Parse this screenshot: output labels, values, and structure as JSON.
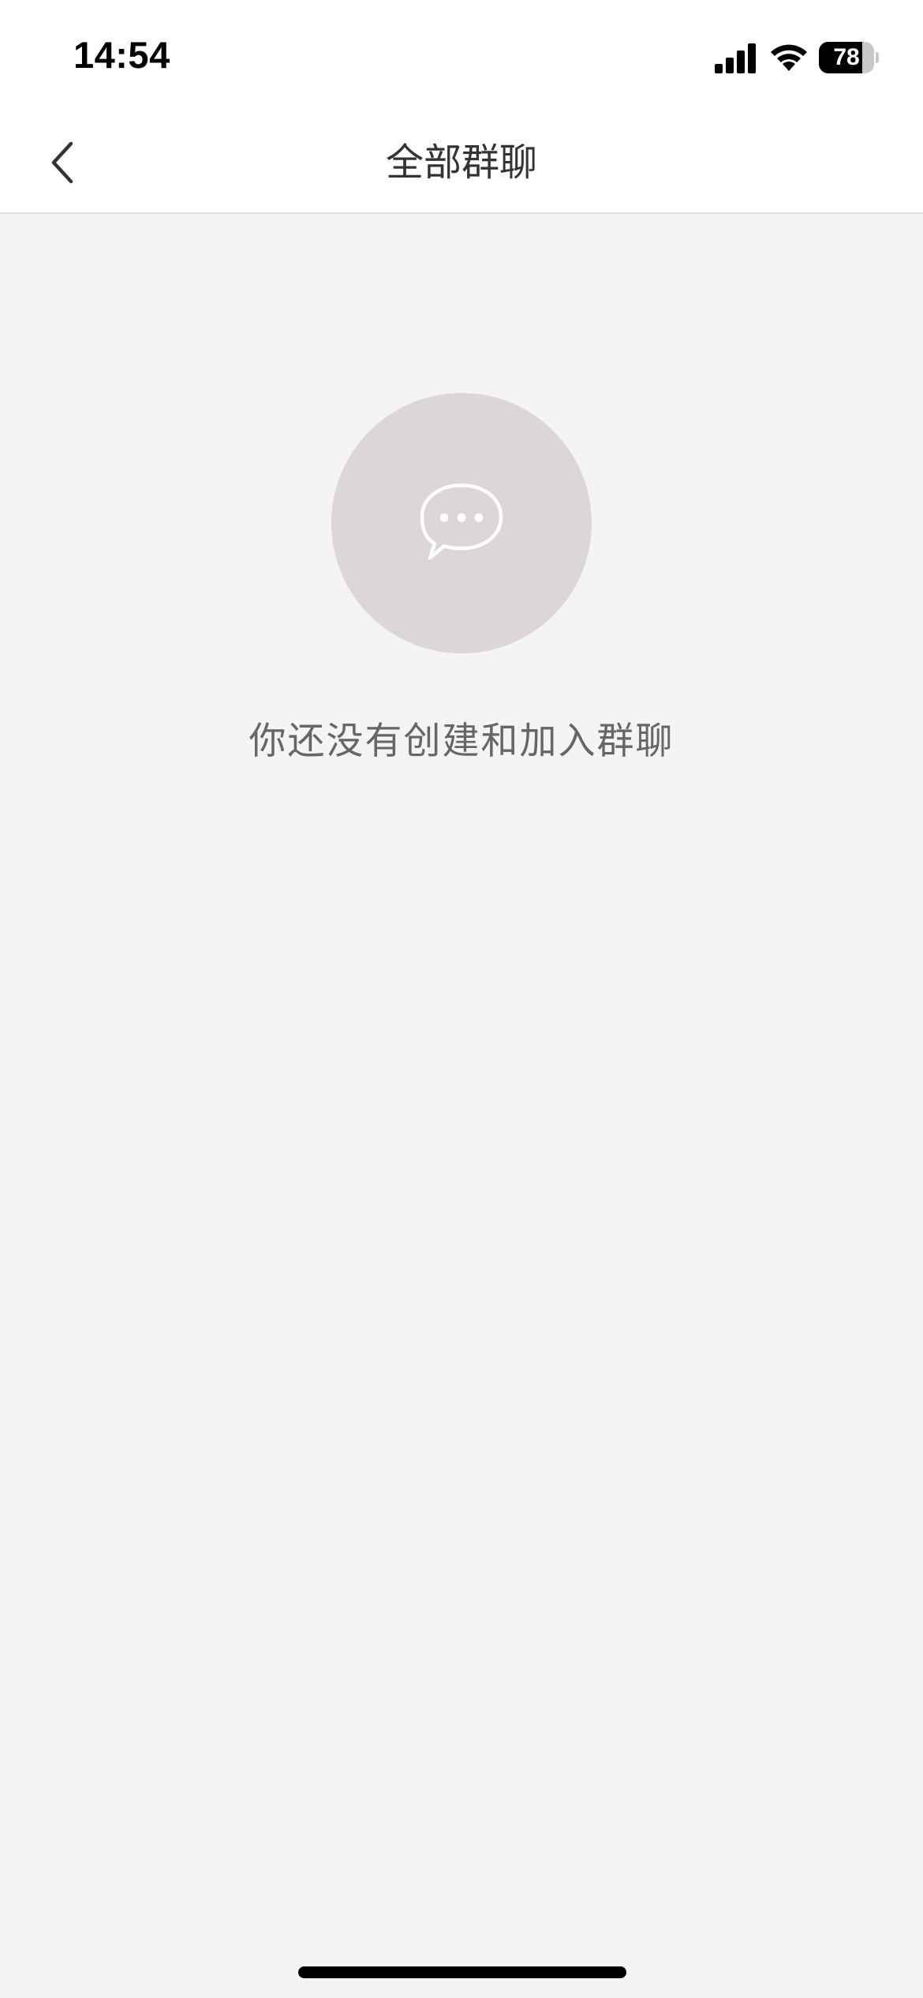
{
  "status_bar": {
    "time": "14:54",
    "battery_level": "78",
    "battery_fraction": 0.78,
    "icons": [
      "signal-icon",
      "wifi-icon",
      "battery-icon"
    ]
  },
  "header": {
    "title": "全部群聊",
    "back_icon": "chevron-left-icon"
  },
  "empty_state": {
    "icon": "chat-bubble-icon",
    "message": "你还没有创建和加入群聊"
  },
  "colors": {
    "background": "#f4f4f4",
    "header_background": "#ffffff",
    "icon_circle": "#dcd6d8",
    "title_text": "#333333",
    "message_text": "#666666"
  }
}
